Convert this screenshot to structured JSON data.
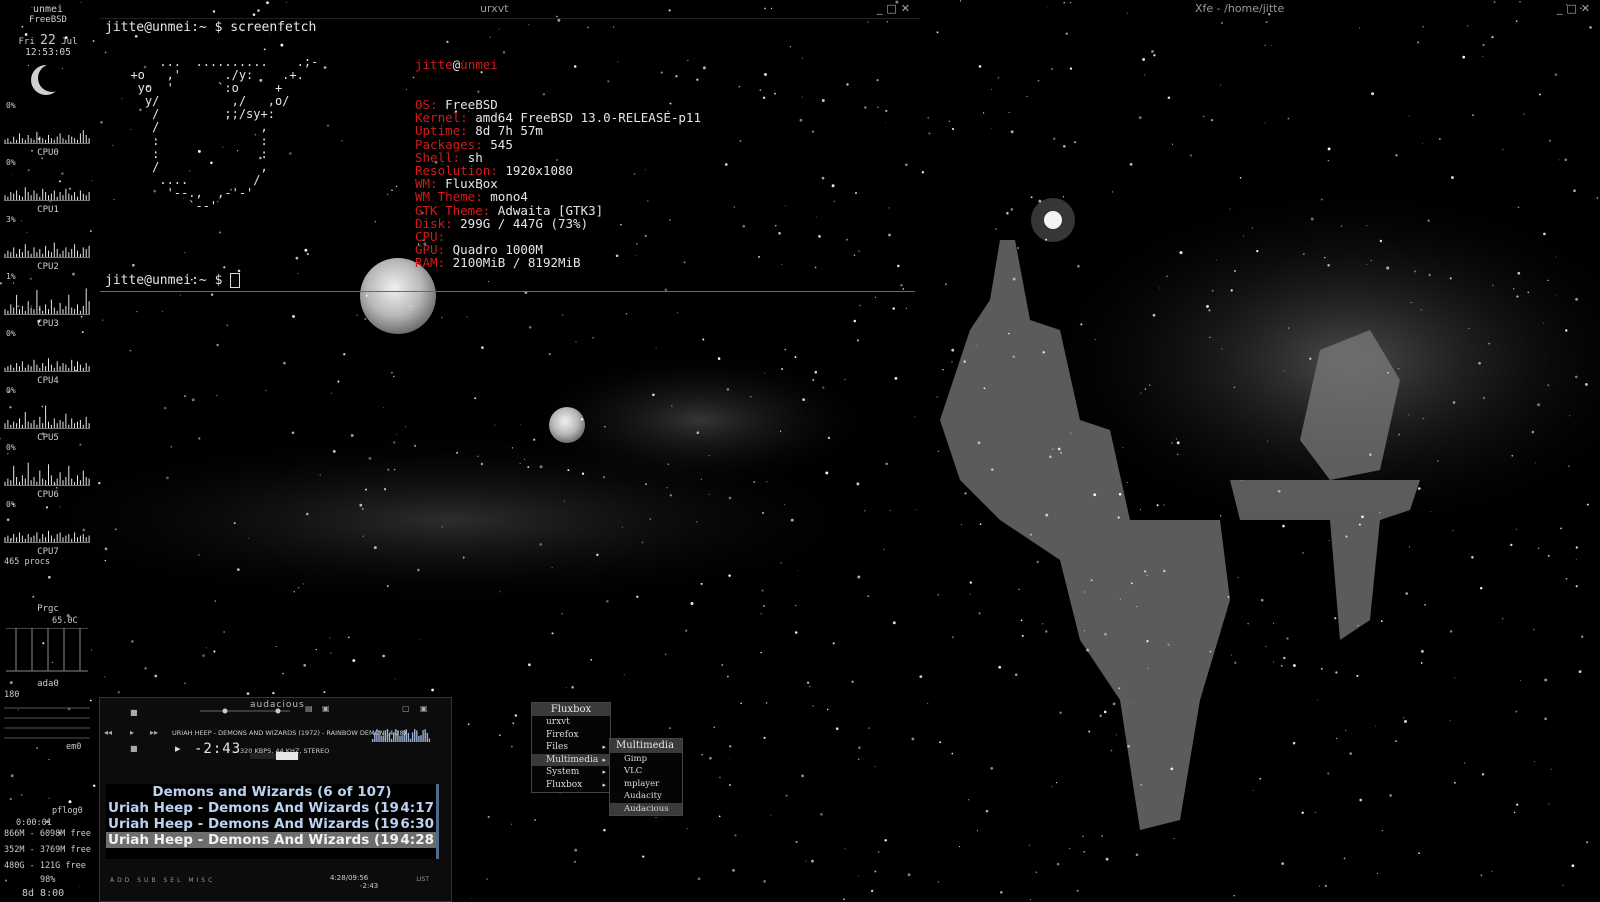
{
  "window_left": {
    "title": "urxvt"
  },
  "window_right": {
    "title": "Xfe - /home/jitte"
  },
  "conky": {
    "host": "unmei",
    "os": "FreeBSD",
    "day": "Fri",
    "date_num": "22",
    "month": "Jul",
    "time": "12:53:05",
    "cpus": [
      {
        "name": "CPU0",
        "pct": "0%",
        "load": [
          2,
          3,
          1,
          4,
          2,
          6,
          3,
          2,
          5,
          3,
          2,
          7,
          4,
          3,
          2,
          5,
          3,
          2,
          4,
          6,
          3,
          2,
          5,
          4,
          3,
          2,
          6,
          8,
          5,
          3
        ]
      },
      {
        "name": "CPU1",
        "pct": "0%",
        "load": [
          3,
          2,
          5,
          4,
          6,
          3,
          2,
          8,
          5,
          3,
          6,
          4,
          2,
          7,
          5,
          3,
          4,
          6,
          2,
          5,
          3,
          7,
          4,
          3,
          5,
          2,
          6,
          4,
          3,
          5
        ]
      },
      {
        "name": "CPU2",
        "pct": "3%",
        "load": [
          2,
          4,
          3,
          6,
          2,
          5,
          3,
          8,
          4,
          2,
          6,
          3,
          5,
          2,
          7,
          4,
          3,
          9,
          5,
          2,
          4,
          6,
          3,
          5,
          8,
          4,
          2,
          6,
          5,
          7
        ]
      },
      {
        "name": "CPU3",
        "pct": "1%",
        "load": [
          3,
          2,
          6,
          4,
          12,
          3,
          5,
          2,
          8,
          4,
          3,
          15,
          5,
          2,
          6,
          3,
          9,
          4,
          2,
          7,
          3,
          5,
          12,
          4,
          3,
          6,
          2,
          5,
          16,
          8
        ]
      },
      {
        "name": "CPU4",
        "pct": "0%",
        "load": [
          2,
          3,
          4,
          2,
          5,
          3,
          6,
          2,
          4,
          3,
          7,
          4,
          2,
          5,
          3,
          8,
          4,
          2,
          6,
          3,
          5,
          4,
          2,
          7,
          3,
          6,
          4,
          2,
          5,
          3
        ]
      },
      {
        "name": "CPU5",
        "pct": "0%",
        "load": [
          3,
          5,
          2,
          4,
          3,
          6,
          2,
          10,
          4,
          3,
          5,
          2,
          7,
          3,
          14,
          4,
          2,
          6,
          3,
          5,
          4,
          9,
          2,
          6,
          3,
          4,
          5,
          2,
          7,
          3
        ]
      },
      {
        "name": "CPU6",
        "pct": "0%",
        "load": [
          2,
          4,
          3,
          12,
          5,
          2,
          6,
          4,
          14,
          3,
          5,
          2,
          9,
          4,
          3,
          13,
          6,
          2,
          4,
          8,
          3,
          5,
          12,
          4,
          2,
          6,
          3,
          9,
          5,
          4
        ]
      },
      {
        "name": "CPU7",
        "pct": "0%",
        "load": [
          3,
          4,
          2,
          5,
          3,
          6,
          4,
          2,
          5,
          3,
          4,
          6,
          2,
          5,
          3,
          7,
          4,
          2,
          5,
          6,
          3,
          4,
          5,
          2,
          6,
          3,
          4,
          5,
          3,
          4
        ]
      }
    ],
    "procs": "465 procs",
    "proc_label": "Prgc",
    "temp": "65.0C",
    "disk": "ada0",
    "disk_val": "180",
    "net": "em0",
    "pf": "pflog0",
    "uptime_small": "0:00:01",
    "mem1": "866M - 6098M free",
    "mem2": "352M - 3769M free",
    "mem3": "480G - 121G free",
    "swap": "98%",
    "uptime": "8d 8:00"
  },
  "terminal": {
    "prompt1": "jitte@unmei:~ $ screenfetch",
    "prompt2": "jitte@unmei:~ $ ",
    "ascii_art": "      ...  ..........    .;-\n  +o   ,'      ./y:    .+.\n   yo  '      `:o     +\n    y/          ,/   ,o/\n     /         ;;/sy+:\n     /              ,\n     :              :\n     :              :\n     /              ,\n      ....         /\n       '--.,  ,-'-'\n          `--'",
    "user": "jitte",
    "host": "unmei",
    "info": [
      {
        "k": "OS: ",
        "v": "FreeBSD"
      },
      {
        "k": "Kernel: ",
        "v": "amd64 FreeBSD 13.0-RELEASE-p11"
      },
      {
        "k": "Uptime: ",
        "v": "8d 7h 57m"
      },
      {
        "k": "Packages: ",
        "v": "545"
      },
      {
        "k": "Shell: ",
        "v": "sh"
      },
      {
        "k": "Resolution: ",
        "v": "1920x1080"
      },
      {
        "k": "WM: ",
        "v": "FluxBox"
      },
      {
        "k": "WM Theme: ",
        "v": "mono4"
      },
      {
        "k": "GTK Theme: ",
        "v": "Adwaita [GTK3]"
      },
      {
        "k": "Disk: ",
        "v": "299G / 447G (73%)"
      },
      {
        "k": "CPU: ",
        "v": ""
      },
      {
        "k": "GPU: ",
        "v": "Quadro 1000M"
      },
      {
        "k": "RAM: ",
        "v": "2100MiB / 8192MiB"
      }
    ]
  },
  "audacious": {
    "logo": "audacious",
    "track_title": "URIAH HEEP - DEMONS AND WIZARDS (1972) - RAINBOW DEMON (4:28)",
    "time": "-2:43",
    "meta": "320 KBPS, 44 KHZ, STEREO",
    "playlist": [
      {
        "text": "Demons and Wizards (6 of 107)",
        "dur": ""
      },
      {
        "text": "Uriah Heep - Demons And Wizards (19",
        "dur": "4:17"
      },
      {
        "text": "Uriah Heep - Demons And Wizards (19",
        "dur": "6:30"
      },
      {
        "text": "Uriah Heep - Demons And Wizards (19",
        "dur": "4:28"
      }
    ],
    "bottom_buttons": "ADD SUB SEL MISC",
    "bottom_time": "4:28/09:56",
    "bottom_time2": "-2:43",
    "list_label": "LIST"
  },
  "fluxbox_menu": {
    "title": "Fluxbox",
    "items": [
      {
        "label": "urxvt",
        "sub": false
      },
      {
        "label": "Firefox",
        "sub": false
      },
      {
        "label": "Files",
        "sub": true
      },
      {
        "label": "Multimedia",
        "sub": true
      },
      {
        "label": "System",
        "sub": true
      },
      {
        "label": "Fluxbox",
        "sub": true
      }
    ],
    "submenu_title": "Multimedia",
    "submenu_items": [
      "Gimp",
      "VLC",
      "mplayer",
      "Audacity",
      "Audacious"
    ]
  },
  "colors": {
    "accent_red": "#d21a1a",
    "playlist_text": "#bcd2f0",
    "selection": "#6d6d6d"
  }
}
